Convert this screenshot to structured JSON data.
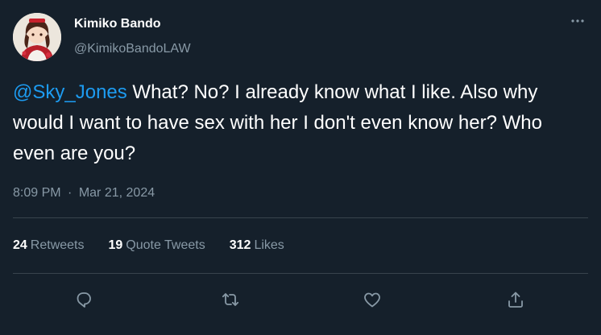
{
  "author": {
    "display_name": "Kimiko Bando",
    "handle": "@KimikoBandoLAW",
    "avatar_icon": "avatar-anime-character"
  },
  "tweet": {
    "mention": "@Sky_Jones",
    "text": " What? No? I already know what I like. Also why would I want to have sex with her I don't even know her? Who even are you?",
    "time": "8:09 PM",
    "separator": "·",
    "date": "Mar 21, 2024"
  },
  "stats": {
    "retweets_count": "24",
    "retweets_label": "Retweets",
    "quotes_count": "19",
    "quotes_label": "Quote Tweets",
    "likes_count": "312",
    "likes_label": "Likes"
  },
  "actions": {
    "icons": [
      "reply-icon",
      "retweet-icon",
      "like-icon",
      "share-icon"
    ]
  },
  "colors": {
    "background": "#15202b",
    "text_primary": "#ffffff",
    "text_secondary": "#8899a6",
    "accent": "#1d9bf0",
    "divider": "#38444d"
  }
}
